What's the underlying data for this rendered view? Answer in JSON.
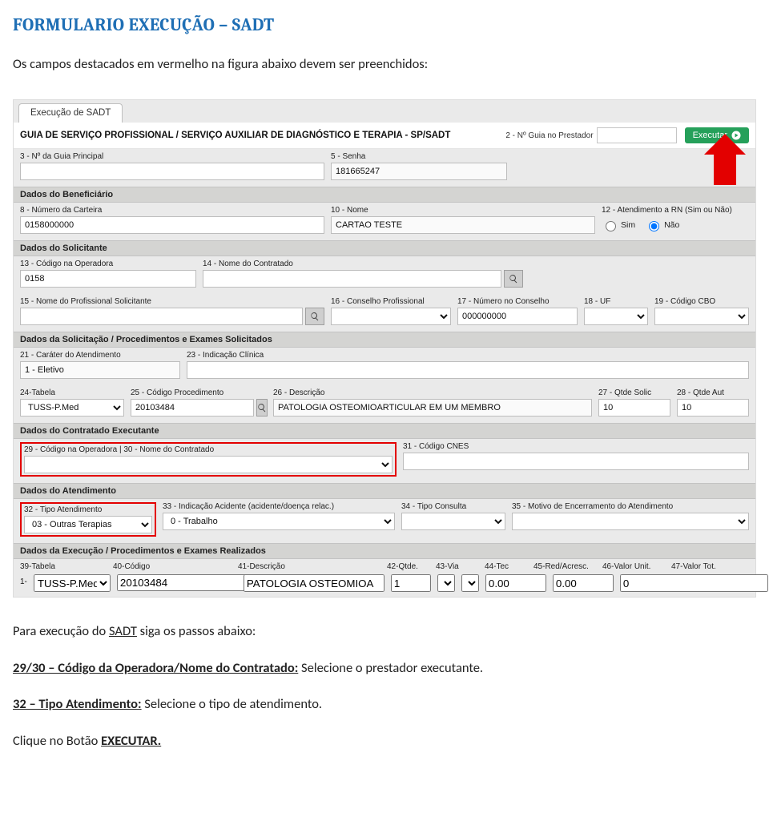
{
  "doc": {
    "title": "FORMULARIO EXECUÇÃO – SADT",
    "intro": "Os campos destacados em vermelho na figura abaixo devem ser preenchidos:"
  },
  "tab": "Execução de SADT",
  "header": {
    "title": "GUIA DE SERVIÇO PROFISSIONAL / SERVIÇO AUXILIAR DE DIAGNÓSTICO E TERAPIA - SP/SADT",
    "guia_no_label": "2 - Nº Guia no Prestador",
    "executar": "Executar"
  },
  "f3": {
    "label": "3 - Nº da Guia Principal",
    "value": ""
  },
  "f5": {
    "label": "5 - Senha",
    "value": "181665247"
  },
  "sec_benef": "Dados do Beneficiário",
  "f8": {
    "label": "8 - Número da Carteira",
    "value": "0158000000"
  },
  "f10": {
    "label": "10 - Nome",
    "value": "CARTAO TESTE"
  },
  "f12": {
    "label": "12 - Atendimento a RN (Sim ou Não)",
    "sim": "Sim",
    "nao": "Não"
  },
  "sec_solic": "Dados do Solicitante",
  "f13": {
    "label": "13 - Código na Operadora",
    "value": "0158"
  },
  "f14": {
    "label": "14 - Nome do Contratado",
    "value": ""
  },
  "f15": {
    "label": "15 - Nome do Profissional Solicitante",
    "value": ""
  },
  "f16": {
    "label": "16 - Conselho Profissional",
    "value": ""
  },
  "f17": {
    "label": "17 - Número no Conselho",
    "value": "000000000"
  },
  "f18": {
    "label": "18 - UF",
    "value": ""
  },
  "f19": {
    "label": "19 - Código CBO",
    "value": ""
  },
  "sec_proc": "Dados da Solicitação / Procedimentos e Exames Solicitados",
  "f21": {
    "label": "21 - Caráter do Atendimento",
    "value": "1 - Eletivo"
  },
  "f23": {
    "label": "23 - Indicação Clínica",
    "value": ""
  },
  "f24": {
    "label": "24-Tabela",
    "value": "TUSS-P.Med"
  },
  "f25": {
    "label": "25 - Código Procedimento",
    "value": "20103484"
  },
  "f26": {
    "label": "26 - Descrição",
    "value": "PATOLOGIA OSTEOMIOARTICULAR EM UM MEMBRO"
  },
  "f27": {
    "label": "27 - Qtde Solic",
    "value": "10"
  },
  "f28": {
    "label": "28 - Qtde Aut",
    "value": "10"
  },
  "sec_exec": "Dados do Contratado Executante",
  "f2930": {
    "label": "29 - Código na Operadora | 30 - Nome do Contratado",
    "value": ""
  },
  "f31": {
    "label": "31 - Código CNES",
    "value": ""
  },
  "sec_atend": "Dados do Atendimento",
  "f32": {
    "label": "32 - Tipo Atendimento",
    "value": "03 - Outras Terapias"
  },
  "f33": {
    "label": "33 - Indicação Acidente (acidente/doença relac.)",
    "value": "0 - Trabalho"
  },
  "f34": {
    "label": "34 - Tipo Consulta",
    "value": ""
  },
  "f35": {
    "label": "35 - Motivo de Encerramento do Atendimento",
    "value": ""
  },
  "sec_execproc": "Dados da Execução / Procedimentos e Exames Realizados",
  "hdr": {
    "c39": "39-Tabela",
    "c40": "40-Código",
    "c41": "41-Descrição",
    "c42": "42-Qtde.",
    "c43": "43-Via",
    "c44": "44-Tec",
    "c45": "45-Red/Acresc.",
    "c46": "46-Valor Unit.",
    "c47": "47-Valor Tot."
  },
  "line1": {
    "idx": "1-",
    "tab": "TUSS-P.Med",
    "cod": "20103484",
    "desc": "PATOLOGIA OSTEOMIOA",
    "qt": "1",
    "via": "",
    "tec": "",
    "red": "0.00",
    "vu": "0.00",
    "vt": "0"
  },
  "post": {
    "intro_a": "Para execução do ",
    "intro_sadt": "SADT",
    "intro_b": " siga os passos abaixo:",
    "step_29_a": "29/30 – Código da Operadora/Nome do Contratado:",
    "step_29_b": " Selecione o prestador executante.",
    "step_32_a": "32 – Tipo Atendimento:",
    "step_32_b": " Selecione o tipo de atendimento.",
    "final_a": "Clique no Botão ",
    "final_b": "EXECUTAR."
  }
}
